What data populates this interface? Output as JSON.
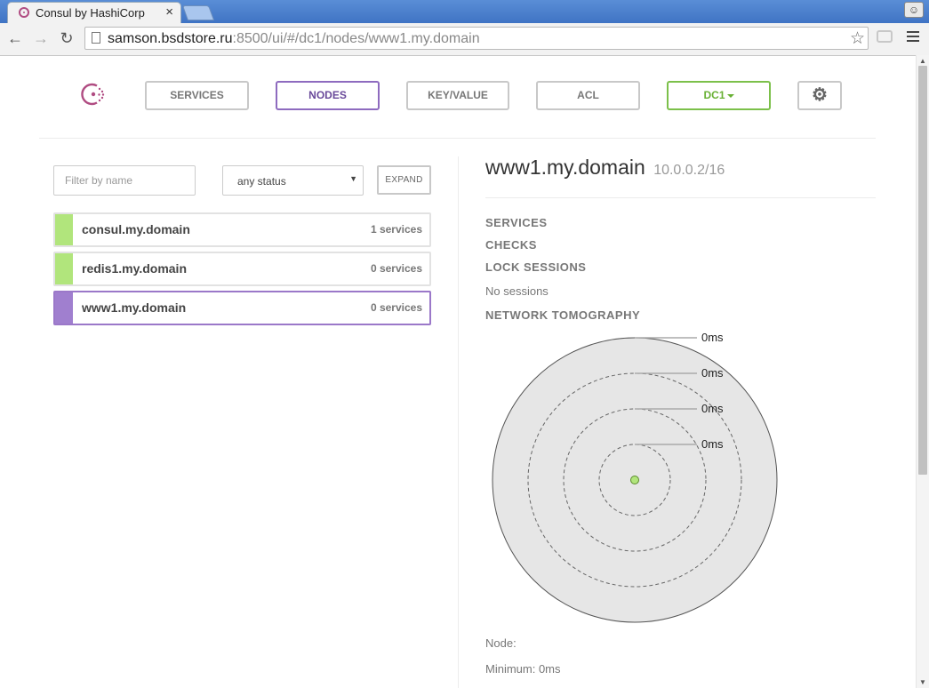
{
  "browser": {
    "tab_title": "Consul by HashiCorp",
    "tab_close": "×",
    "url_host": "samson.bsdstore.ru",
    "url_rest": ":8500/ui/#/dc1/nodes/www1.my.domain",
    "back_glyph": "←",
    "forward_glyph": "→",
    "reload_glyph": "↻",
    "star_glyph": "☆"
  },
  "nav": {
    "services": "SERVICES",
    "nodes": "NODES",
    "key_value": "KEY/VALUE",
    "acl": "ACL",
    "datacenter": "DC1",
    "settings_glyph": "⚙"
  },
  "filter": {
    "placeholder": "Filter by name",
    "status": "any status",
    "expand": "EXPAND"
  },
  "nodes": [
    {
      "name": "consul.my.domain",
      "services": "1 services",
      "status": "passing"
    },
    {
      "name": "redis1.my.domain",
      "services": "0 services",
      "status": "passing"
    },
    {
      "name": "www1.my.domain",
      "services": "0 services",
      "status": "selected"
    }
  ],
  "detail": {
    "name": "www1.my.domain",
    "address": "10.0.0.2/16",
    "services_heading": "SERVICES",
    "checks_heading": "CHECKS",
    "lock_sessions_heading": "LOCK SESSIONS",
    "no_sessions": "No sessions",
    "network_tomography_heading": "NETWORK TOMOGRAPHY",
    "ring_labels": [
      "0ms",
      "0ms",
      "0ms",
      "0ms"
    ],
    "node_label": "Node:",
    "minimum": "Minimum: 0ms"
  },
  "colors": {
    "passing": "#b1e57c",
    "selected": "#a07fcf",
    "brand": "#b04c82",
    "tomography_fill": "#e6e6e6"
  }
}
